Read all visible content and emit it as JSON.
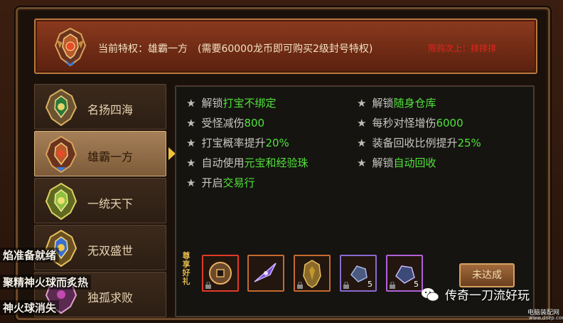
{
  "banner": {
    "current_label": "当前特权：雄霸一方",
    "requirement_text": "(需要60000龙币即可购买2级封号特权)",
    "link_text": "限购次上：排排排"
  },
  "tabs": [
    {
      "label": "名扬四海",
      "active": false
    },
    {
      "label": "雄霸一方",
      "active": true
    },
    {
      "label": "一统天下",
      "active": false
    },
    {
      "label": "无双盛世",
      "active": false
    },
    {
      "label": "独孤求败",
      "active": false
    }
  ],
  "perks_left": [
    {
      "prefix": "解锁",
      "highlight": "打宝不绑定",
      "suffix": ""
    },
    {
      "prefix": "受怪减伤",
      "highlight": "800",
      "suffix": ""
    },
    {
      "prefix": "打宝概率提升",
      "highlight": "20%",
      "suffix": ""
    },
    {
      "prefix": "自动使用",
      "highlight": "元宝和经验珠",
      "suffix": ""
    },
    {
      "prefix": "开启",
      "highlight": "交易行",
      "suffix": ""
    }
  ],
  "perks_right": [
    {
      "prefix": "解锁",
      "highlight": "随身仓库",
      "suffix": ""
    },
    {
      "prefix": "每秒对怪增伤",
      "highlight": "6000",
      "suffix": ""
    },
    {
      "prefix": "装备回收比例提升",
      "highlight": "25%",
      "suffix": ""
    },
    {
      "prefix": "解锁",
      "highlight": "自动回收",
      "suffix": ""
    }
  ],
  "rewards": {
    "title": "尊享好礼",
    "items": [
      {
        "icon": "coin-icon",
        "count": ""
      },
      {
        "icon": "blade-icon",
        "count": ""
      },
      {
        "icon": "armor-icon",
        "count": ""
      },
      {
        "icon": "ore-icon",
        "count": "5"
      },
      {
        "icon": "ore-icon",
        "count": "5"
      }
    ],
    "button_label": "未达成"
  },
  "chat": [
    "焰准备就绪",
    "聚精神火球而炙热",
    "神火球消失"
  ],
  "watermark": {
    "title": "传奇一刀流好玩",
    "site_cn": "电脑装配网",
    "site_url": "www.dnzp.com"
  },
  "colors": {
    "highlight_green": "#52e23a",
    "banner_red": "#8c3a1e",
    "link_red": "#e8231f",
    "arrow_gold": "#f0c23a"
  }
}
